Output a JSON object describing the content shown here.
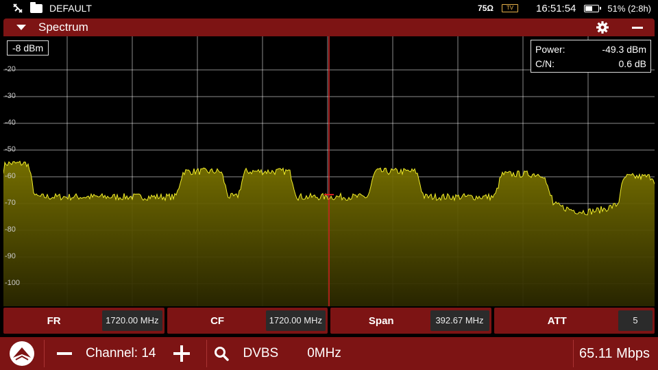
{
  "status_bar": {
    "profile": "DEFAULT",
    "impedance": "75Ω",
    "time": "16:51:54",
    "battery": "51% (2:8h)",
    "battery_level": 0.51,
    "icons": [
      "satellite-icon",
      "folder-icon",
      "tv-icon",
      "battery-icon"
    ]
  },
  "panel": {
    "title": "Spectrum",
    "icons": [
      "collapse-icon",
      "gear-icon",
      "minus-icon"
    ]
  },
  "spectrum": {
    "ref_level": "-8 dBm",
    "power_label": "Power:",
    "power_value": "-49.3 dBm",
    "cn_label": "C/N:",
    "cn_value": "0.6 dB",
    "y_ticks": [
      "-20",
      "-30",
      "-40",
      "-50",
      "-60",
      "-70",
      "-80",
      "-90",
      "-100"
    ],
    "colors": {
      "trace": "#f3ef2a",
      "fill_top": "#7a7300",
      "fill_bottom": "#2a2700",
      "grid": "#ffffff",
      "marker": "#d42020"
    }
  },
  "params": [
    {
      "label": "FR",
      "value": "1720.00 MHz"
    },
    {
      "label": "CF",
      "value": "1720.00 MHz"
    },
    {
      "label": "Span",
      "value": "392.67 MHz"
    },
    {
      "label": "ATT",
      "value": "5"
    }
  ],
  "bottom_bar": {
    "channel": "Channel: 14",
    "standard": "DVBS",
    "offset": "0MHz",
    "bitrate": "65.11 Mbps"
  },
  "colors": {
    "brand_red": "#7d1414",
    "background": "#000000"
  }
}
